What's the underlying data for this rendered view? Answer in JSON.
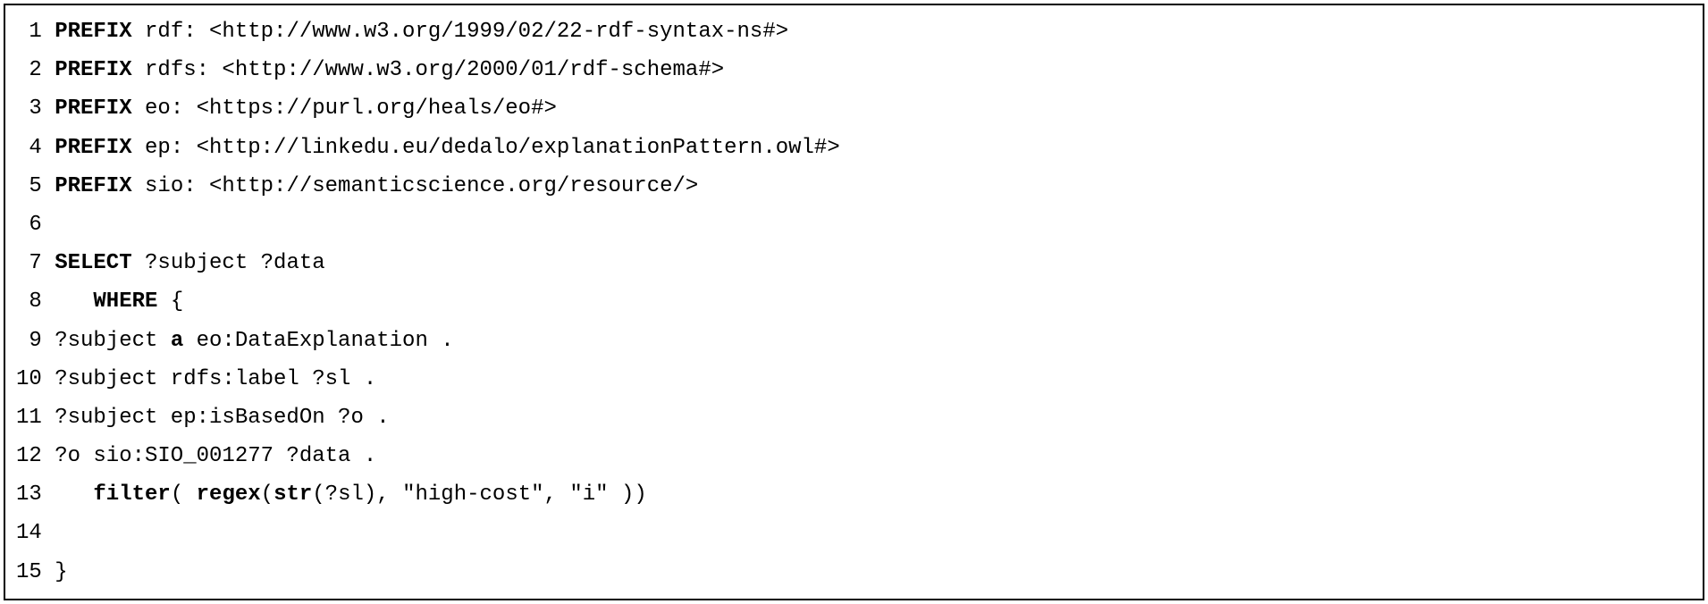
{
  "lines": [
    {
      "n": "1",
      "tokens": [
        {
          "t": "PREFIX",
          "b": true
        },
        {
          "t": " rdf: <http://www.w3.org/1999/02/22-rdf-syntax-ns#>",
          "b": false
        }
      ]
    },
    {
      "n": "2",
      "tokens": [
        {
          "t": "PREFIX",
          "b": true
        },
        {
          "t": " rdfs: <http://www.w3.org/2000/01/rdf-schema#>",
          "b": false
        }
      ]
    },
    {
      "n": "3",
      "tokens": [
        {
          "t": "PREFIX",
          "b": true
        },
        {
          "t": " eo: <https://purl.org/heals/eo#>",
          "b": false
        }
      ]
    },
    {
      "n": "4",
      "tokens": [
        {
          "t": "PREFIX",
          "b": true
        },
        {
          "t": " ep: <http://linkedu.eu/dedalo/explanationPattern.owl#>",
          "b": false
        }
      ]
    },
    {
      "n": "5",
      "tokens": [
        {
          "t": "PREFIX",
          "b": true
        },
        {
          "t": " sio: <http://semanticscience.org/resource/>",
          "b": false
        }
      ]
    },
    {
      "n": "6",
      "tokens": [
        {
          "t": "",
          "b": false
        }
      ]
    },
    {
      "n": "7",
      "tokens": [
        {
          "t": "SELECT",
          "b": true
        },
        {
          "t": " ?subject ?data",
          "b": false
        }
      ]
    },
    {
      "n": "8",
      "tokens": [
        {
          "t": "   ",
          "b": false
        },
        {
          "t": "WHERE",
          "b": true
        },
        {
          "t": " {",
          "b": false
        }
      ]
    },
    {
      "n": "9",
      "tokens": [
        {
          "t": "?subject ",
          "b": false
        },
        {
          "t": "a",
          "b": true
        },
        {
          "t": " eo:DataExplanation .",
          "b": false
        }
      ]
    },
    {
      "n": "10",
      "tokens": [
        {
          "t": "?subject rdfs:label ?sl .",
          "b": false
        }
      ]
    },
    {
      "n": "11",
      "tokens": [
        {
          "t": "?subject ep:isBasedOn ?o .",
          "b": false
        }
      ]
    },
    {
      "n": "12",
      "tokens": [
        {
          "t": "?o sio:SIO_001277 ?data .",
          "b": false
        }
      ]
    },
    {
      "n": "13",
      "tokens": [
        {
          "t": "   ",
          "b": false
        },
        {
          "t": "filter",
          "b": true
        },
        {
          "t": "( ",
          "b": false
        },
        {
          "t": "regex",
          "b": true
        },
        {
          "t": "(",
          "b": false
        },
        {
          "t": "str",
          "b": true
        },
        {
          "t": "(?sl), \"high-cost\", \"i\" ))",
          "b": false
        }
      ]
    },
    {
      "n": "14",
      "tokens": [
        {
          "t": "",
          "b": false
        }
      ]
    },
    {
      "n": "15",
      "tokens": [
        {
          "t": "}",
          "b": false
        }
      ]
    }
  ]
}
